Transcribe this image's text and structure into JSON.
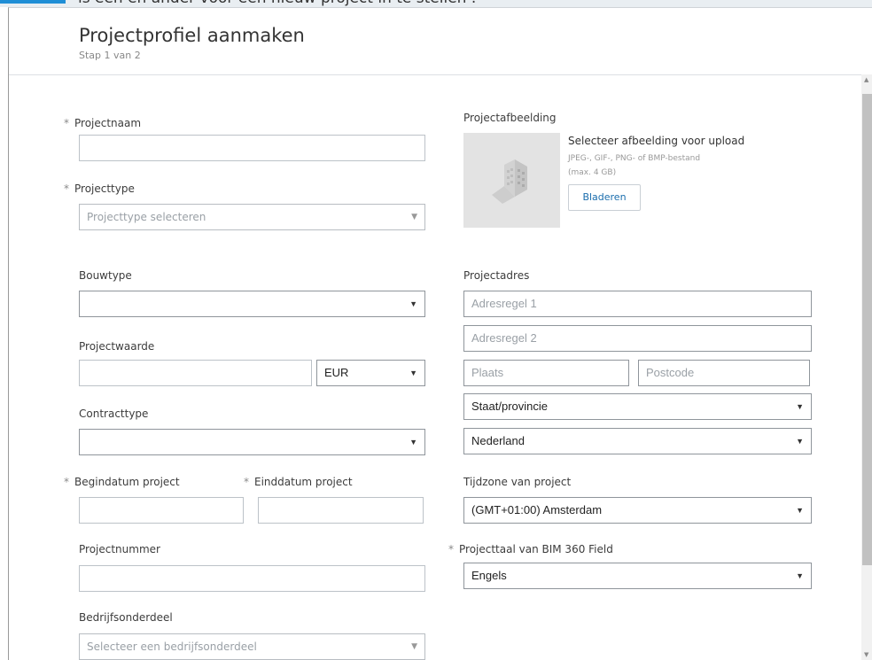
{
  "background_hint": "ls een en ander voor een nieuw project in te stellen .",
  "dialog": {
    "title": "Projectprofiel aanmaken",
    "step": "Stap 1 van 2"
  },
  "form": {
    "project_name": {
      "label": "Projectnaam",
      "value": ""
    },
    "project_type": {
      "label": "Projecttype",
      "placeholder": "Projecttype selecteren"
    },
    "construction_type": {
      "label": "Bouwtype",
      "value": ""
    },
    "project_value": {
      "label": "Projectwaarde",
      "value": "",
      "currency": "EUR"
    },
    "contract_type": {
      "label": "Contracttype",
      "value": ""
    },
    "start_date": {
      "label": "Begindatum project",
      "value": ""
    },
    "end_date": {
      "label": "Einddatum project",
      "value": ""
    },
    "project_number": {
      "label": "Projectnummer",
      "value": ""
    },
    "business_unit": {
      "label": "Bedrijfsonderdeel",
      "placeholder": "Selecteer een bedrijfsonderdeel"
    },
    "project_image": {
      "label": "Projectafbeelding",
      "upload_title": "Selecteer afbeelding voor upload",
      "formats": "JPEG-, GIF-, PNG- of BMP-bestand",
      "max_size": "(max. 4 GB)",
      "browse_label": "Bladeren"
    },
    "project_address": {
      "label": "Projectadres",
      "line1_placeholder": "Adresregel 1",
      "line2_placeholder": "Adresregel 2",
      "city_placeholder": "Plaats",
      "postcode_placeholder": "Postcode",
      "state": "Staat/provincie",
      "country": "Nederland"
    },
    "timezone": {
      "label": "Tijdzone van project",
      "value": "(GMT+01:00) Amsterdam"
    },
    "field_language": {
      "label": "Projecttaal van BIM 360 Field",
      "value": "Engels"
    }
  },
  "icons": {
    "dropdown": "▼",
    "required": "*",
    "image_placeholder": "building-placeholder-icon"
  },
  "colors": {
    "accent": "#1f8ed6",
    "link": "#1a6dad",
    "border": "#bcc2c8",
    "scrollbar_thumb": "#c1c1c1"
  }
}
